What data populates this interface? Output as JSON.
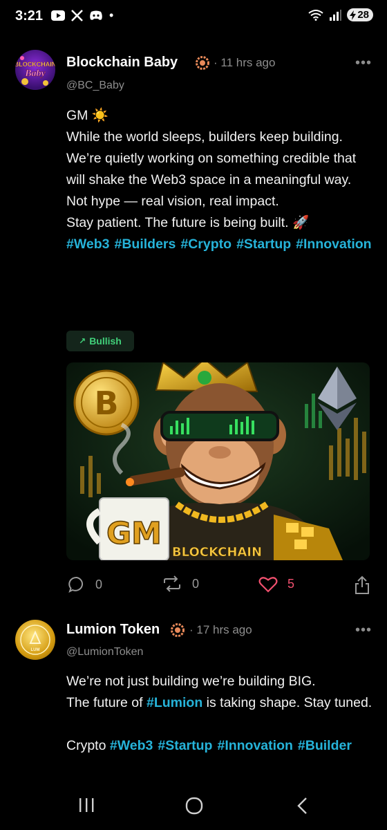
{
  "status_bar": {
    "time": "3:21",
    "battery": "28",
    "dot": "•"
  },
  "posts": [
    {
      "author": "Blockchain Baby",
      "avatar_text": [
        "BLOCKCHAIN",
        "Baby"
      ],
      "time_ago": "· 11 hrs ago",
      "handle": "@BC_Baby",
      "more": "•••",
      "lines": [
        "GM ☀️",
        "While the world sleeps, builders keep building.",
        "We’re quietly working on something credible that will shake the Web3 space in a meaningful way. Not hype — real vision, real impact.",
        "Stay patient. The future is being built. 🚀"
      ],
      "hashtags": [
        "#Web3",
        "#Builders",
        "#Crypto",
        "#Startup",
        "#Innovation"
      ],
      "sentiment": {
        "icon": "↗",
        "label": "Bullish"
      },
      "image_text": {
        "mug": "GM",
        "banner": "BLOCKCHAIN",
        "coin": "B"
      },
      "comments": "0",
      "reposts": "0",
      "likes": "5"
    },
    {
      "author": "Lumion Token",
      "avatar_text": "LUM",
      "time_ago": "· 17 hrs ago",
      "handle": "@LumionToken",
      "more": "•••",
      "line1": "We’re not just building we’re building BIG.",
      "line2_pre": "The future of ",
      "line2_tag": "#Lumion",
      "line2_post": " is taking shape. Stay tuned.",
      "line3_pre": "Crypto ",
      "hashtags": [
        "#Web3",
        "#Startup",
        "#Innovation",
        "#Builder"
      ]
    }
  ],
  "colors": {
    "accent": "#26b3d9",
    "bullish": "#41d07a",
    "like": "#f0506e",
    "muted": "#8d8d8d"
  }
}
